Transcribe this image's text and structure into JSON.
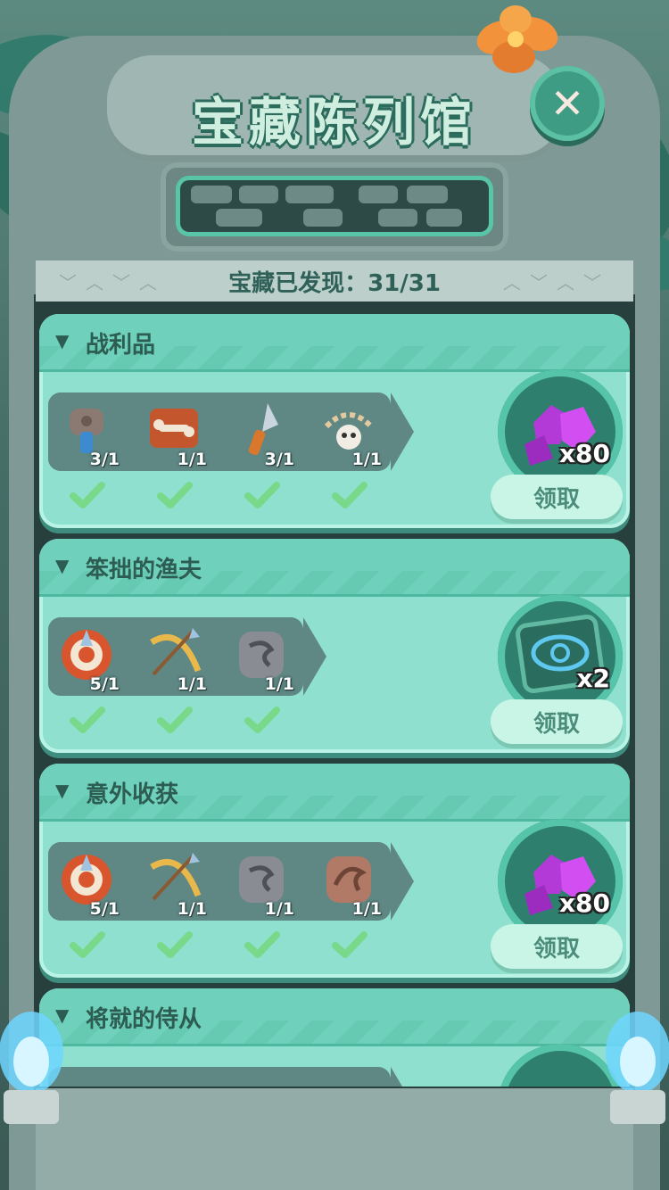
{
  "header": {
    "title": "宝藏陈列馆",
    "discover_label": "宝藏已发现：31/31",
    "close_icon_name": "close-icon"
  },
  "colors": {
    "accent": "#6fd1bb",
    "card_bg": "#8fe0cf",
    "check_green": "#79d98a",
    "title_green": "#cfeee0"
  },
  "collections": [
    {
      "title": "战利品",
      "items": [
        {
          "icon": "bottle-icon",
          "count": "3/1"
        },
        {
          "icon": "bone-icon",
          "count": "1/1"
        },
        {
          "icon": "spear-tip-icon",
          "count": "3/1"
        },
        {
          "icon": "skull-necklace-icon",
          "count": "1/1"
        }
      ],
      "reward": {
        "icon": "purple-gem-icon",
        "qty": "x80"
      },
      "claim_label": "领取"
    },
    {
      "title": "笨拙的渔夫",
      "items": [
        {
          "icon": "target-arrow-icon",
          "count": "5/1"
        },
        {
          "icon": "bow-icon",
          "count": "1/1"
        },
        {
          "icon": "serpent-stone-icon",
          "count": "1/1"
        }
      ],
      "reward": {
        "icon": "eye-card-icon",
        "qty": "x2"
      },
      "claim_label": "领取"
    },
    {
      "title": "意外收获",
      "items": [
        {
          "icon": "target-arrow-icon",
          "count": "5/1"
        },
        {
          "icon": "bow-icon",
          "count": "1/1"
        },
        {
          "icon": "serpent-stone-icon",
          "count": "1/1"
        },
        {
          "icon": "dragon-stone-icon",
          "count": "1/1"
        }
      ],
      "reward": {
        "icon": "purple-gem-icon",
        "qty": "x80"
      },
      "claim_label": "领取"
    },
    {
      "title": "将就的侍从",
      "items": [],
      "reward": {
        "icon": "eye-card-icon",
        "qty": ""
      },
      "claim_label": ""
    }
  ]
}
